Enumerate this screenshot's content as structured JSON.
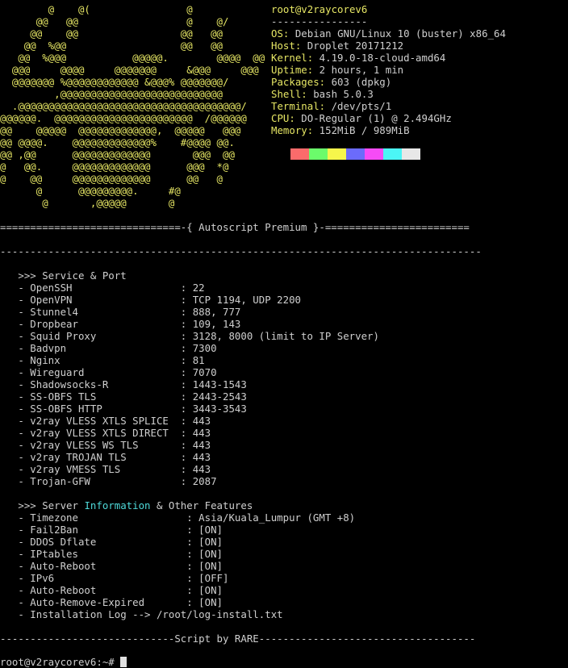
{
  "neofetch": {
    "logo_lines": [
      "        @    @(                @        ",
      "      @@   @@                  @    @/",
      "     @@    @@                 @@   @@",
      "    @@  %@@                   @@   @@",
      "   @@  %@@@           @@@@@.        @@@@  @@",
      "  @@@     @@@@     @@@@@@@     &@@@     @@@",
      "  @@@@@@@ %@@@@@@@@@@@@ &@@@% @@@@@@@/",
      "         ,@@@@@@@@@@@@@@@@@@@@@@@@@@@",
      "  .@@@@@@@@@@@@@@@@@@@@@@@@@@@@@@@@@@@@@/",
      "@@@@@@.  @@@@@@@@@@@@@@@@@@@@@@@  /@@@@@@",
      "@@    @@@@@  @@@@@@@@@@@@@,  @@@@@   @@@",
      "@@ @@@@.    @@@@@@@@@@@@@%    #@@@@ @@.",
      "@@ ,@@      @@@@@@@@@@@@@       @@@  @@",
      "@   @@.     @@@@@@@@@@@@@      @@@  *@",
      "@    @@     @@@@@@@@@@@@@      @@   @",
      "      @      @@@@@@@@@.     #@",
      "       @       ,@@@@@       @"
    ],
    "user_host": "root@v2raycorev6",
    "separator": "----------------",
    "fields": [
      {
        "label": "OS:",
        "value": " Debian GNU/Linux 10 (buster) x86_64"
      },
      {
        "label": "Host:",
        "value": " Droplet 20171212"
      },
      {
        "label": "Kernel:",
        "value": " 4.19.0-18-cloud-amd64"
      },
      {
        "label": "Uptime:",
        "value": " 2 hours, 1 min"
      },
      {
        "label": "Packages:",
        "value": " 603 (dpkg)"
      },
      {
        "label": "Shell:",
        "value": " bash 5.0.3"
      },
      {
        "label": "Terminal:",
        "value": " /dev/pts/1"
      },
      {
        "label": "CPU:",
        "value": " DO-Regular (1) @ 2.494GHz"
      },
      {
        "label": "Memory:",
        "value": " 152MiB / 989MiB"
      }
    ],
    "palette": [
      "#fb6b6b",
      "#6bfb6b",
      "#f6f64b",
      "#6b6bfb",
      "#f64bf6",
      "#4bf6f6",
      "#e8e8e8"
    ]
  },
  "autoscript": {
    "banner": "==============================-{ Autoscript Premium }-========================",
    "dash_line": "--------------------------------------------------------------------------------",
    "service_header": "   >>> Service & Port",
    "services": [
      "   - OpenSSH                  : 22",
      "   - OpenVPN                  : TCP 1194, UDP 2200",
      "   - Stunnel4                 : 888, 777",
      "   - Dropbear                 : 109, 143",
      "   - Squid Proxy              : 3128, 8000 (limit to IP Server)",
      "   - Badvpn                   : 7300",
      "   - Nginx                    : 81",
      "   - Wireguard                : 7070",
      "   - Shadowsocks-R            : 1443-1543",
      "   - SS-OBFS TLS              : 2443-2543",
      "   - SS-OBFS HTTP             : 3443-3543",
      "   - v2ray VLESS XTLS SPLICE  : 443",
      "   - v2ray VLESS XTLS DIRECT  : 443",
      "   - v2ray VLESS WS TLS       : 443",
      "   - v2ray TROJAN TLS         : 443",
      "   - v2ray VMESS TLS          : 443",
      "   - Trojan-GFW               : 2087"
    ],
    "server_header_pre": "   >>> Server ",
    "server_header_highlight": "Information",
    "server_header_post": " & Other Features",
    "features": [
      "   - Timezone                  : Asia/Kuala_Lumpur (GMT +8)",
      "   - Fail2Ban                  : [ON]",
      "   - DDOS Dflate               : [ON]",
      "   - IPtables                  : [ON]",
      "   - Auto-Reboot               : [ON]",
      "   - IPv6                      : [OFF]",
      "   - Auto-Reboot               : [ON]",
      "   - Auto-Remove-Expired       : [ON]",
      "   - Installation Log --> /root/log-install.txt"
    ],
    "footer": "-----------------------------Script by RARE------------------------------------"
  },
  "prompt": "root@v2raycorev6:~# "
}
